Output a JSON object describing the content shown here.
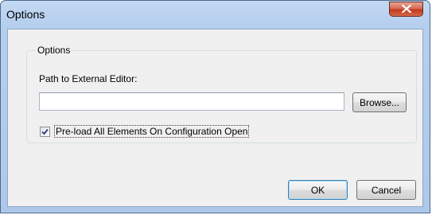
{
  "window": {
    "title": "Options"
  },
  "group": {
    "label": "Options"
  },
  "path_field": {
    "label": "Path to External Editor:",
    "value": "",
    "browse_label": "Browse..."
  },
  "preload": {
    "label": "Pre-load All Elements On Configuration Open",
    "checked": true
  },
  "buttons": {
    "ok_label": "OK",
    "cancel_label": "Cancel"
  },
  "icons": {
    "close": "close-icon",
    "checkmark": "checkmark-icon"
  },
  "colors": {
    "close_button": "#c2391d",
    "title_bar": "#b6cfee",
    "dialog_body": "#f0f0f0",
    "checkmark": "#2b3f7a"
  }
}
